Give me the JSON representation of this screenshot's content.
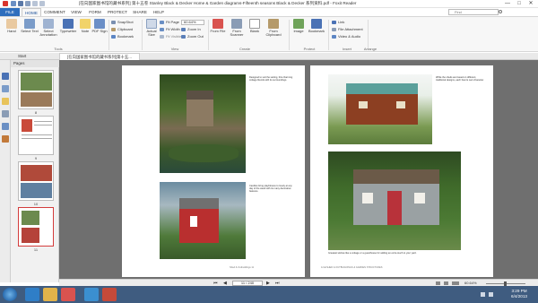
{
  "window": {
    "title": "[在向国家图书馆的藏书系列] 第十五卷 Stanley Black & Decker Home & Garden diagrams-Fifteenth seasons Black & Decker 系列资料.pdf - Foxit Reader",
    "min_glyph": "—",
    "max_glyph": "□",
    "close_glyph": "✕"
  },
  "menu": {
    "tabs": [
      "FILE",
      "HOME",
      "COMMENT",
      "VIEW",
      "FORM",
      "PROTECT",
      "SHARE",
      "HELP"
    ],
    "active": "HOME",
    "find_placeholder": "Find"
  },
  "ribbon": {
    "tools": {
      "hand": "Hand",
      "select_text": "Select Text",
      "select_annotation": "Select Annotation",
      "typewriter": "Typewriter",
      "note": "Note",
      "pdf_sign": "PDF Sign",
      "label": "Tools"
    },
    "clipboard": {
      "snapshot": "SnapShot",
      "clipboard": "Clipboard",
      "bookmark": "Bookmark"
    },
    "view": {
      "actual_size": "Actual Size",
      "fit_page": "Fit Page",
      "fit_width": "Fit Width",
      "fit_visible": "Fit Visible",
      "zoom_value": "60.64%",
      "zoom_in": "Zoom In",
      "zoom_out": "Zoom Out",
      "rotate": "Rotate",
      "label": "View"
    },
    "create": {
      "from_file": "From File",
      "from_scanner": "From Scanner",
      "blank": "Blank",
      "from_clipboard": "From Clipboard",
      "label": "Create"
    },
    "protect": {
      "image": "Image",
      "bookmark": "Bookmark",
      "label": "Protect"
    },
    "insert": {
      "link": "Link",
      "file_attachment": "File Attachment",
      "video_audio": "Video & Audio",
      "label": "Insert"
    },
    "arrange": {
      "label": "Arrange"
    }
  },
  "doc_tabs": {
    "start": "Start",
    "document": "[在向国家图书馆的藏书系列]第十五..."
  },
  "panel": {
    "title": "Pages",
    "thumbs": [
      {
        "num": "8",
        "selected": false
      },
      {
        "num": "9",
        "selected": false
      },
      {
        "num": "10",
        "selected": false
      },
      {
        "num": "11",
        "selected": true
      }
    ]
  },
  "pages": {
    "left_caption_1": "Designed to suit the setting, this charming cottage blends with its surroundings.",
    "left_caption_2": "Candles bring playfulness to lovely at any day of the week with its many decorative features.",
    "left_footer": "Shed & Outbuildings  11",
    "right_caption_1": "While the sheds are based on different, traditional designs, each has its own character.",
    "right_caption_2": "Greatest wishes like a cottage or a guesthouse for adding an extra touch to your yard.",
    "right_footer": "12  ■  SHED & OUTBUILDINGS & GARDEN STRUCTURES"
  },
  "nav": {
    "first": "⏮",
    "prev": "◀",
    "page_field": "11 / 240",
    "next": "▶",
    "last": "⏭",
    "zoom": "60.64%"
  },
  "taskbar": {
    "time": "3:29 PM",
    "date": "6/4/2013"
  },
  "colors": {
    "accent": "#2f6ebd",
    "taskbar": "#3f5c80",
    "canvas": "#6f6f6f"
  }
}
